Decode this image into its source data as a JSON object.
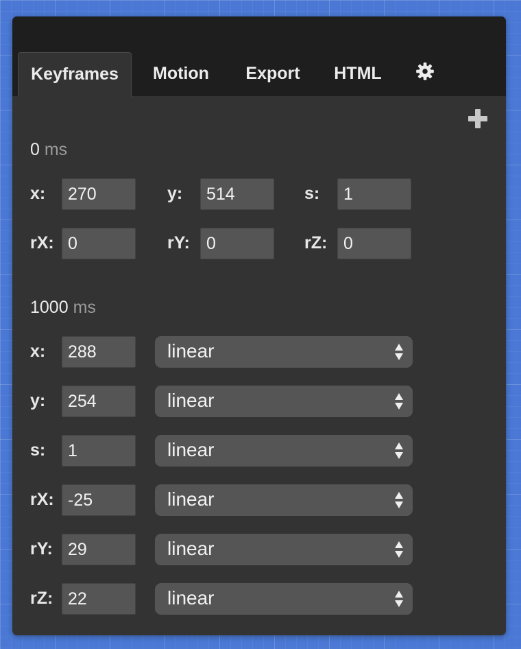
{
  "tabs": [
    {
      "label": "Keyframes",
      "active": true
    },
    {
      "label": "Motion"
    },
    {
      "label": "Export"
    },
    {
      "label": "HTML"
    }
  ],
  "settings_icon": "gear-icon",
  "add_icon": "plus-icon",
  "keyframe0": {
    "time": "0",
    "unit": "ms",
    "fields": [
      {
        "label": "x:",
        "value": "270"
      },
      {
        "label": "y:",
        "value": "514"
      },
      {
        "label": "s:",
        "value": "1"
      },
      {
        "label": "rX:",
        "value": "0"
      },
      {
        "label": "rY:",
        "value": "0"
      },
      {
        "label": "rZ:",
        "value": "0"
      }
    ]
  },
  "keyframe1": {
    "time": "1000",
    "unit": "ms",
    "rows": [
      {
        "label": "x:",
        "value": "288",
        "easing": "linear"
      },
      {
        "label": "y:",
        "value": "254",
        "easing": "linear"
      },
      {
        "label": "s:",
        "value": "1",
        "easing": "linear"
      },
      {
        "label": "rX:",
        "value": "-25",
        "easing": "linear"
      },
      {
        "label": "rY:",
        "value": "29",
        "easing": "linear"
      },
      {
        "label": "rZ:",
        "value": "22",
        "easing": "linear"
      }
    ]
  }
}
